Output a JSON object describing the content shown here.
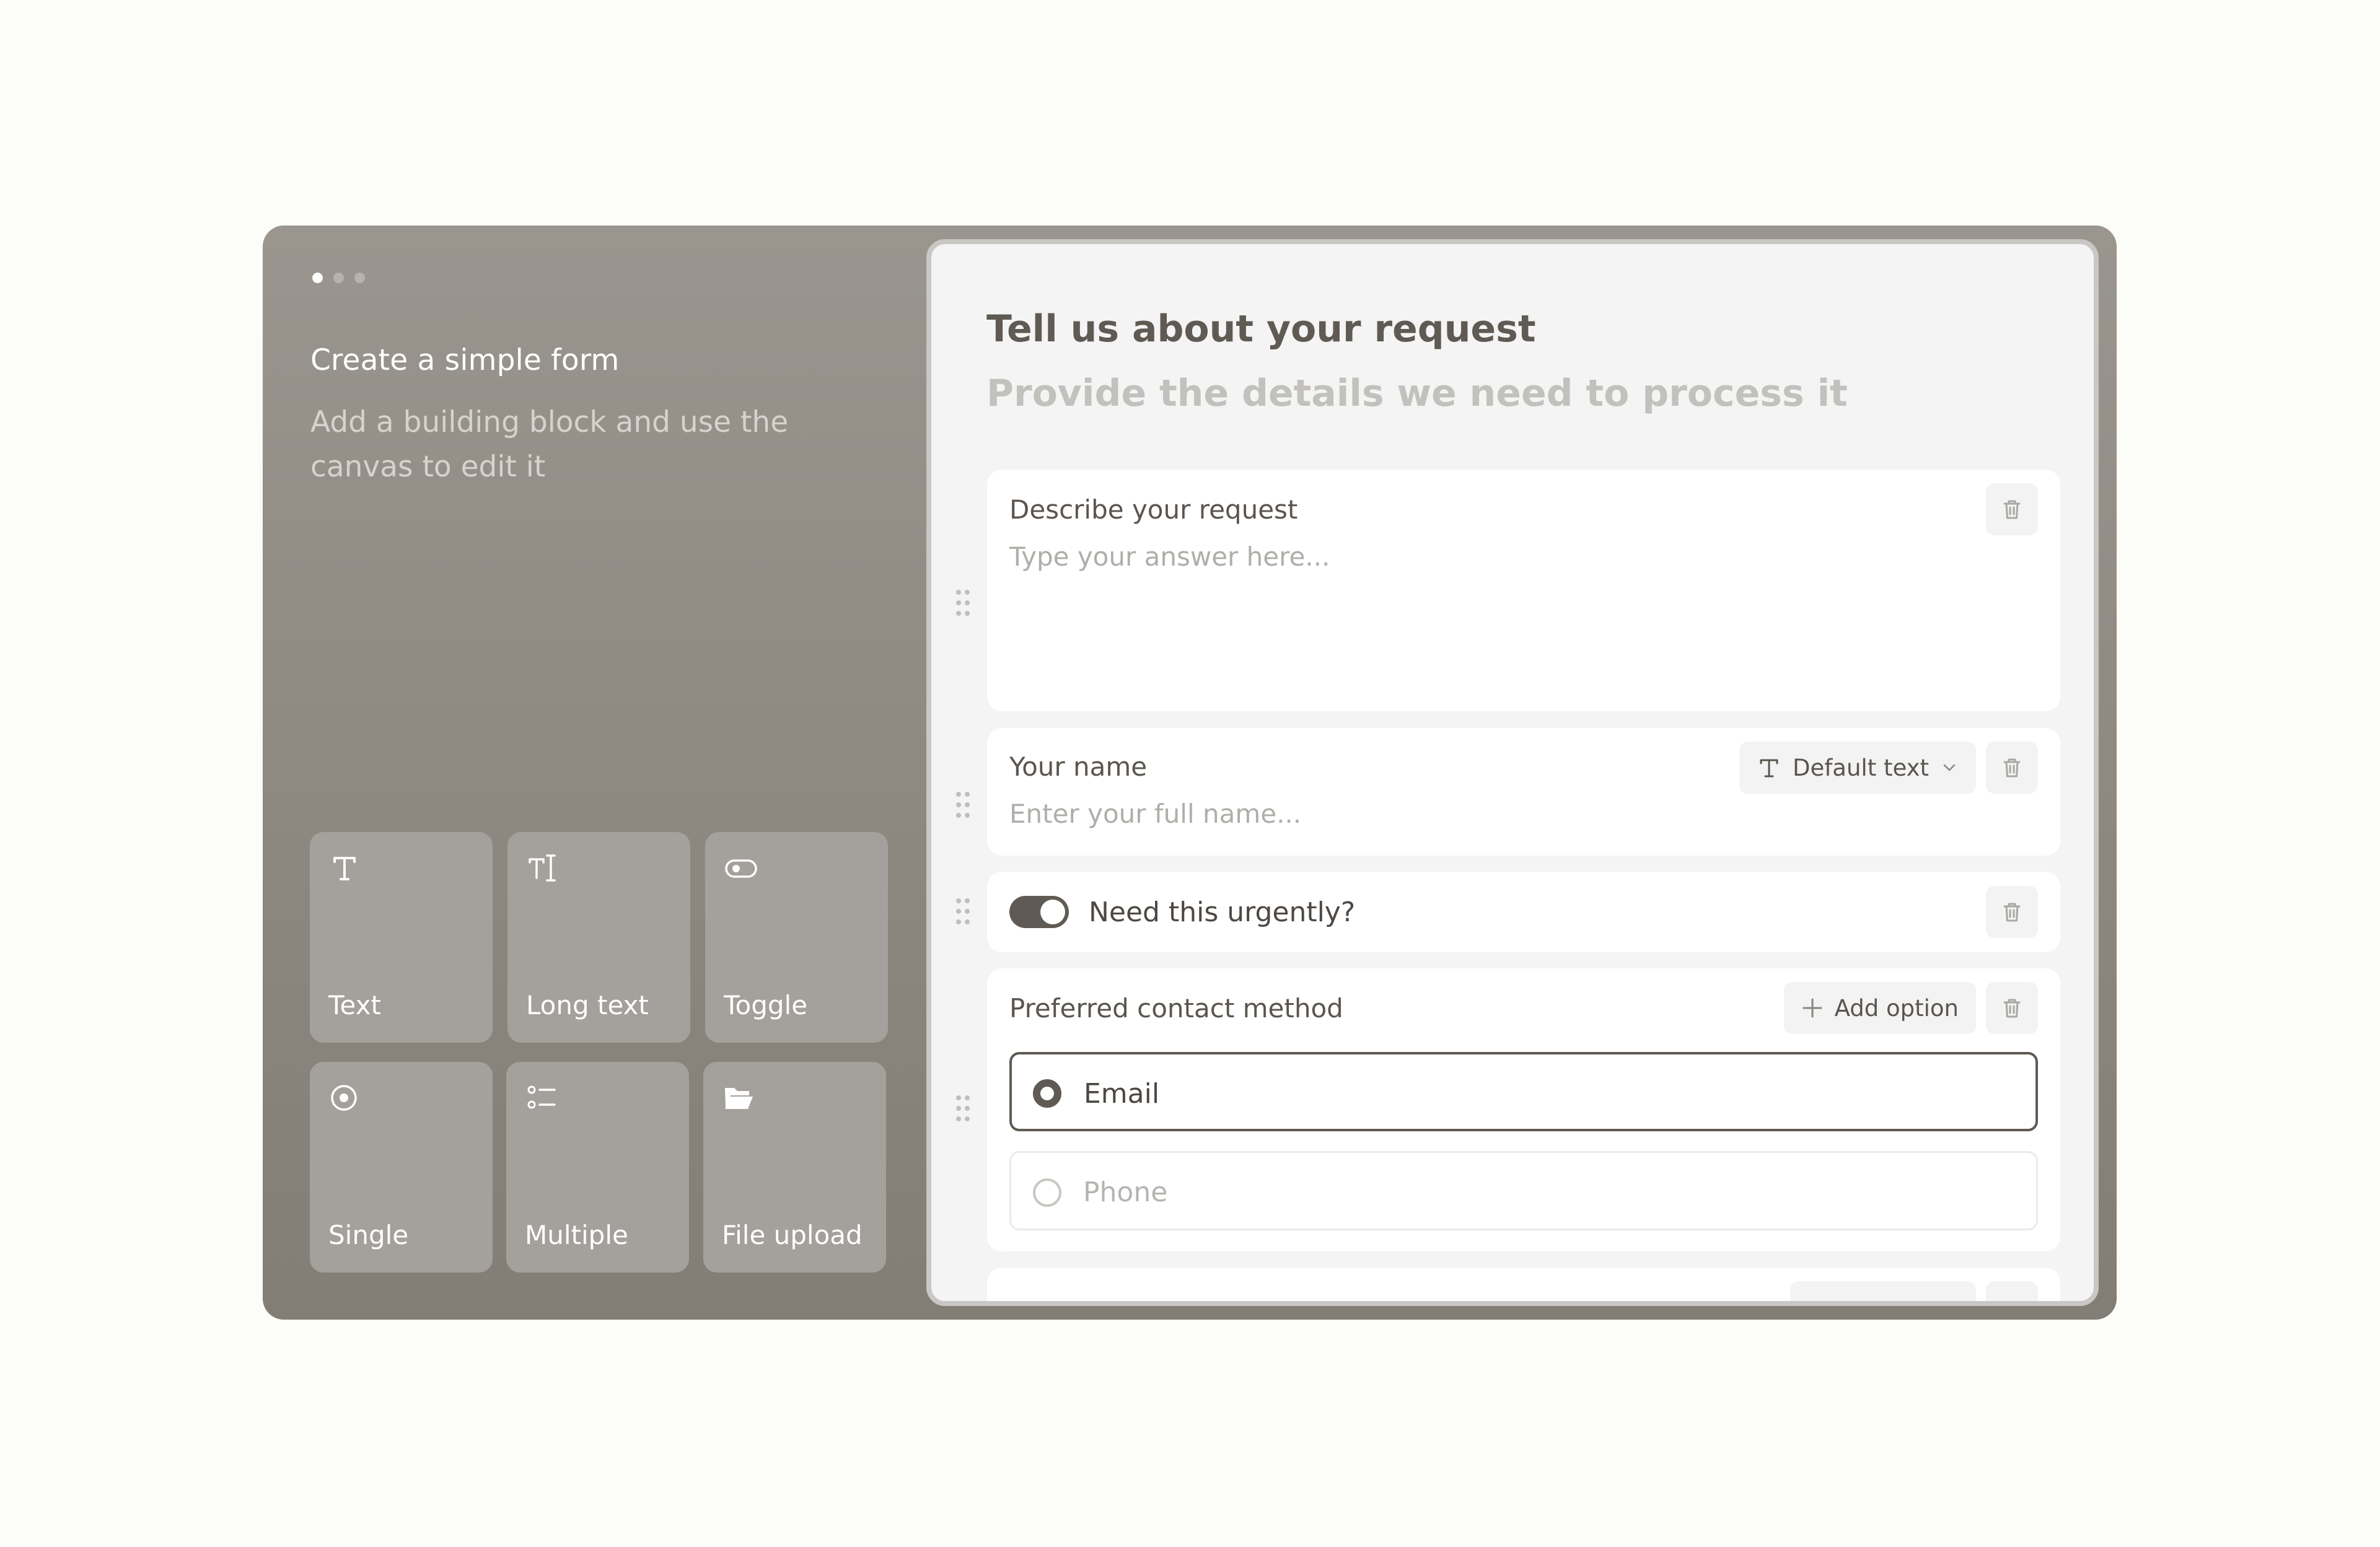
{
  "sidebar": {
    "title": "Create a simple form",
    "subtitle": "Add a building block and use the canvas to edit it",
    "blocks": [
      {
        "label": "Text",
        "icon": "text-icon"
      },
      {
        "label": "Long text",
        "icon": "long-text-icon"
      },
      {
        "label": "Toggle",
        "icon": "toggle-icon"
      },
      {
        "label": "Single",
        "icon": "radio-icon"
      },
      {
        "label": "Multiple",
        "icon": "checklist-icon"
      },
      {
        "label": "File upload",
        "icon": "folder-icon"
      }
    ]
  },
  "form": {
    "title": "Tell us about your request",
    "subtitle": "Provide the details we need to process it",
    "fields": {
      "request": {
        "label": "Describe your request",
        "placeholder": "Type your answer here..."
      },
      "name": {
        "label": "Your name",
        "placeholder": "Enter your full name...",
        "format": "Default text"
      },
      "urgent": {
        "label": "Need this urgently?",
        "on": true
      },
      "contact": {
        "label": "Preferred contact method",
        "add_option": "Add option",
        "options": [
          {
            "label": "Email",
            "selected": true
          },
          {
            "label": "Phone",
            "selected": false
          }
        ]
      }
    }
  },
  "colors": {
    "panel": "#8f8b83",
    "accent": "#5f5a53",
    "canvas": "#f4f4f4"
  }
}
